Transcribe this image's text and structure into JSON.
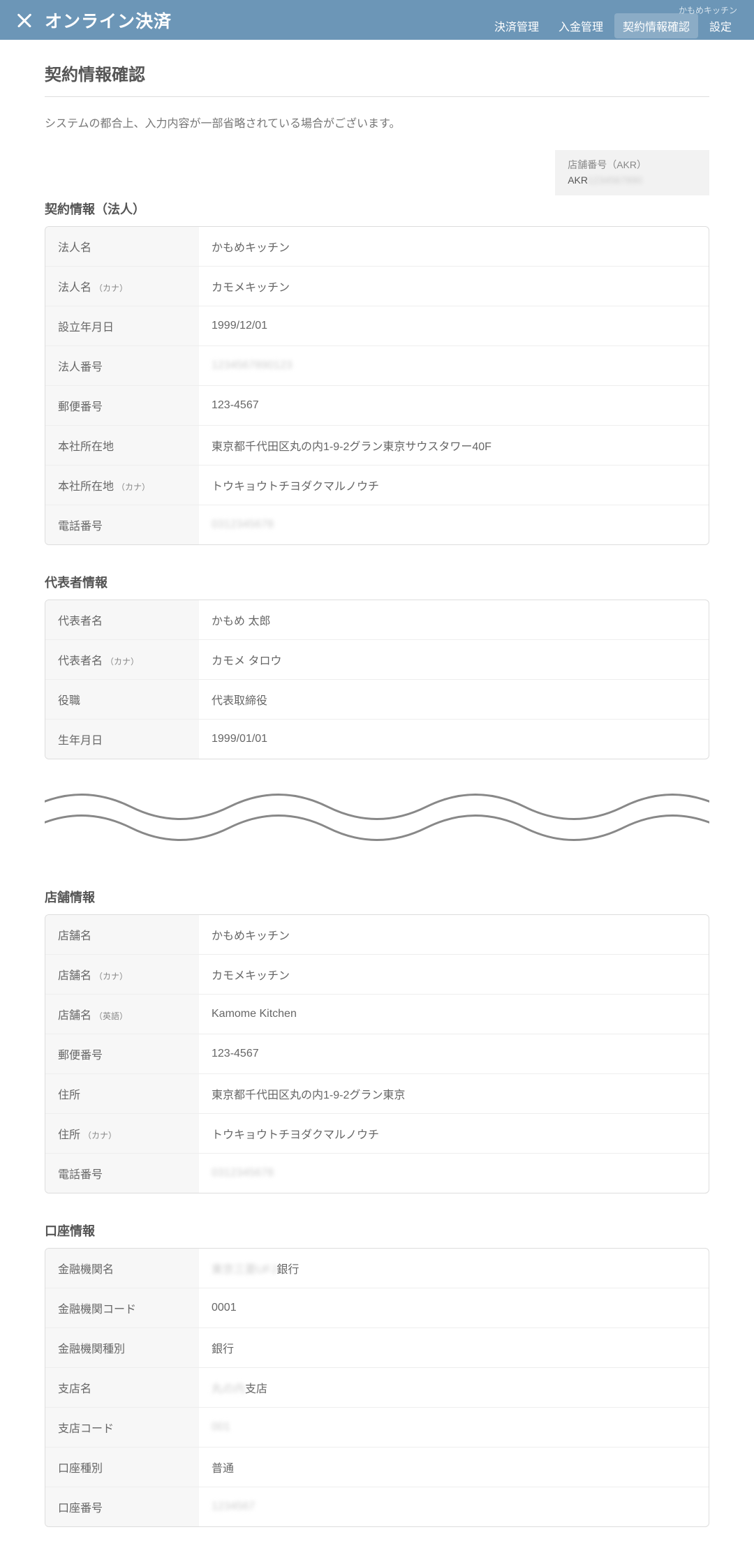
{
  "header": {
    "title": "オンライン決済",
    "restaurant_name": "かもめキッチン",
    "nav": [
      {
        "label": "決済管理",
        "active": false
      },
      {
        "label": "入金管理",
        "active": false
      },
      {
        "label": "契約情報確認",
        "active": true
      },
      {
        "label": "設定",
        "active": false
      }
    ]
  },
  "page_title": "契約情報確認",
  "notice": "システムの都合上、入力内容が一部省略されている場合がございます。",
  "store_badge": {
    "label": "店舗番号（AKR）",
    "prefix": "AKR",
    "value": "1234567890"
  },
  "sections": {
    "corporate": {
      "title": "契約情報（法人）",
      "rows": [
        {
          "label": "法人名",
          "sub": "",
          "value": "かもめキッチン",
          "blurred": false
        },
        {
          "label": "法人名",
          "sub": "（カナ）",
          "value": "カモメキッチン",
          "blurred": false
        },
        {
          "label": "設立年月日",
          "sub": "",
          "value": "1999/12/01",
          "blurred": false
        },
        {
          "label": "法人番号",
          "sub": "",
          "value": "1234567890123",
          "blurred": true
        },
        {
          "label": "郵便番号",
          "sub": "",
          "value": "123-4567",
          "blurred": false
        },
        {
          "label": "本社所在地",
          "sub": "",
          "value": "東京都千代田区丸の内1-9-2グラン東京サウスタワー40F",
          "blurred": false
        },
        {
          "label": "本社所在地",
          "sub": "（カナ）",
          "value": "トウキョウトチヨダクマルノウチ",
          "blurred": false
        },
        {
          "label": "電話番号",
          "sub": "",
          "value": "0312345678",
          "blurred": true
        }
      ]
    },
    "representative": {
      "title": "代表者情報",
      "rows": [
        {
          "label": "代表者名",
          "sub": "",
          "value": "かもめ 太郎",
          "blurred": false
        },
        {
          "label": "代表者名",
          "sub": "（カナ）",
          "value": "カモメ タロウ",
          "blurred": false
        },
        {
          "label": "役職",
          "sub": "",
          "value": "代表取締役",
          "blurred": false
        },
        {
          "label": "生年月日",
          "sub": "",
          "value": "1999/01/01",
          "blurred": false
        }
      ]
    },
    "store": {
      "title": "店舗情報",
      "rows": [
        {
          "label": "店舗名",
          "sub": "",
          "value": "かもめキッチン",
          "blurred": false
        },
        {
          "label": "店舗名",
          "sub": "（カナ）",
          "value": "カモメキッチン",
          "blurred": false
        },
        {
          "label": "店舗名",
          "sub": "（英語）",
          "value": "Kamome Kitchen",
          "blurred": false
        },
        {
          "label": "郵便番号",
          "sub": "",
          "value": "123-4567",
          "blurred": false
        },
        {
          "label": "住所",
          "sub": "",
          "value": "東京都千代田区丸の内1-9-2グラン東京",
          "blurred": false
        },
        {
          "label": "住所",
          "sub": "（カナ）",
          "value": "トウキョウトチヨダクマルノウチ",
          "blurred": false
        },
        {
          "label": "電話番号",
          "sub": "",
          "value": "0312345678",
          "blurred": true
        }
      ]
    },
    "bank": {
      "title": "口座情報",
      "rows": [
        {
          "label": "金融機関名",
          "sub": "",
          "value_prefix_blur": "東京三菱UFJ",
          "value_suffix": "銀行"
        },
        {
          "label": "金融機関コード",
          "sub": "",
          "value": "0001",
          "blurred": false
        },
        {
          "label": "金融機関種別",
          "sub": "",
          "value": "銀行",
          "blurred": false
        },
        {
          "label": "支店名",
          "sub": "",
          "value_prefix_blur": "丸の内",
          "value_suffix": "支店"
        },
        {
          "label": "支店コード",
          "sub": "",
          "value": "001",
          "blurred": true
        },
        {
          "label": "口座種別",
          "sub": "",
          "value": "普通",
          "blurred": false
        },
        {
          "label": "口座番号",
          "sub": "",
          "value": "1234567",
          "blurred": true
        }
      ]
    }
  }
}
